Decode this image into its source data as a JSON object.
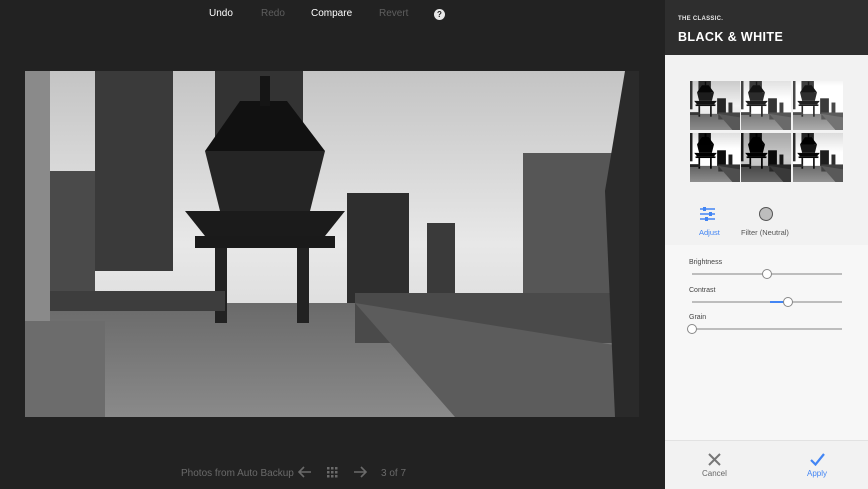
{
  "toolbar": {
    "undo": "Undo",
    "redo": "Redo",
    "compare": "Compare",
    "revert": "Revert",
    "help": "?"
  },
  "bottom": {
    "album": "Photos from Auto Backup",
    "counter": "3 of 7"
  },
  "panel": {
    "kicker": "THE CLASSIC.",
    "title": "BLACK & WHITE",
    "modes": {
      "adjust": "Adjust",
      "filter": "Filter (Neutral)"
    },
    "sliders": [
      {
        "label": "Brightness",
        "value": 0.5
      },
      {
        "label": "Contrast",
        "value": 0.64,
        "fill_from": 0.52
      },
      {
        "label": "Grain",
        "value": 0.0
      }
    ],
    "cancel": "Cancel",
    "apply": "Apply"
  },
  "colors": {
    "accent": "#4285f4",
    "editor_bg": "#222222",
    "panel_header": "#2e2e2e"
  },
  "icons": [
    "help-icon",
    "previous-arrow-icon",
    "grid-icon",
    "next-arrow-icon",
    "sliders-icon",
    "filter-circle-icon",
    "close-icon",
    "check-icon"
  ]
}
